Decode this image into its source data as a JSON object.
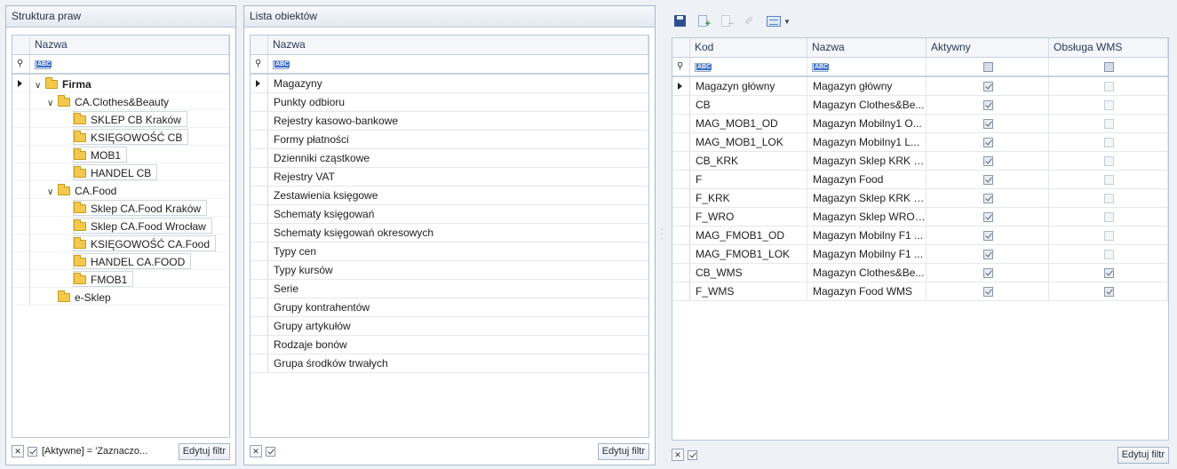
{
  "left_panel": {
    "title": "Struktura praw",
    "column": "Nazwa",
    "filter_placeholder": "ABC",
    "tree": [
      {
        "label": "Firma",
        "level": 0,
        "expanded": true,
        "selected": true,
        "bold": true
      },
      {
        "label": "CA.Clothes&Beauty",
        "level": 1,
        "expanded": true
      },
      {
        "label": "SKLEP CB Kraków",
        "level": 2
      },
      {
        "label": "KSIĘGOWOŚĆ CB",
        "level": 2
      },
      {
        "label": "MOB1",
        "level": 2
      },
      {
        "label": "HANDEL CB",
        "level": 2
      },
      {
        "label": "CA.Food",
        "level": 1,
        "expanded": true
      },
      {
        "label": "Sklep CA.Food Kraków",
        "level": 2
      },
      {
        "label": "Sklep CA.Food Wrocław",
        "level": 2
      },
      {
        "label": "KSIĘGOWOŚĆ CA.Food",
        "level": 2
      },
      {
        "label": "HANDEL CA.FOOD",
        "level": 2
      },
      {
        "label": "FMOB1",
        "level": 2
      },
      {
        "label": "e-Sklep",
        "level": 1
      }
    ],
    "footer_filter_text": "[Aktywne] = 'Zaznaczo...",
    "edit_filter_label": "Edytuj filtr"
  },
  "middle_panel": {
    "title": "Lista obiektów",
    "column": "Nazwa",
    "items": [
      "Magazyny",
      "Punkty odbioru",
      "Rejestry kasowo-bankowe",
      "Formy płatności",
      "Dzienniki cząstkowe",
      "Rejestry VAT",
      "Zestawienia księgowe",
      "Schematy księgowań",
      "Schematy księgowań okresowych",
      "Typy cen",
      "Typy kursów",
      "Serie",
      "Grupy kontrahentów",
      "Grupy artykułów",
      "Rodzaje bonów",
      "Grupa środków trwałych"
    ],
    "edit_filter_label": "Edytuj filtr"
  },
  "right_panel": {
    "toolbar": [
      "save-icon",
      "add-document-icon",
      "remove-document-icon",
      "wrench-icon",
      "grid-layout-icon",
      "dropdown-arrow-icon"
    ],
    "columns": [
      "Kod",
      "Nazwa",
      "Aktywny",
      "Obsługa WMS"
    ],
    "rows": [
      {
        "kod": "Magazyn główny",
        "nazwa": "Magazyn główny",
        "aktywny": true,
        "wms": false
      },
      {
        "kod": "CB",
        "nazwa": "Magazyn Clothes&Be...",
        "aktywny": true,
        "wms": false
      },
      {
        "kod": "MAG_MOB1_OD",
        "nazwa": "Magazyn Mobilny1 O...",
        "aktywny": true,
        "wms": false
      },
      {
        "kod": "MAG_MOB1_LOK",
        "nazwa": "Magazyn Mobilny1 L...",
        "aktywny": true,
        "wms": false
      },
      {
        "kod": "CB_KRK",
        "nazwa": "Magazyn Sklep KRK C...",
        "aktywny": true,
        "wms": false
      },
      {
        "kod": "F",
        "nazwa": "Magazyn Food",
        "aktywny": true,
        "wms": false
      },
      {
        "kod": "F_KRK",
        "nazwa": "Magazyn Sklep KRK F...",
        "aktywny": true,
        "wms": false
      },
      {
        "kod": "F_WRO",
        "nazwa": "Magazyn Sklep WRO ...",
        "aktywny": true,
        "wms": false
      },
      {
        "kod": "MAG_FMOB1_OD",
        "nazwa": "Magazyn Mobilny F1 ...",
        "aktywny": true,
        "wms": false
      },
      {
        "kod": "MAG_FMOB1_LOK",
        "nazwa": "Magazyn Mobilny F1 ...",
        "aktywny": true,
        "wms": false
      },
      {
        "kod": "CB_WMS",
        "nazwa": "Magazyn Clothes&Be...",
        "aktywny": true,
        "wms": true
      },
      {
        "kod": "F_WMS",
        "nazwa": "Magazyn Food WMS",
        "aktywny": true,
        "wms": true
      }
    ],
    "edit_filter_label": "Edytuj filtr"
  }
}
